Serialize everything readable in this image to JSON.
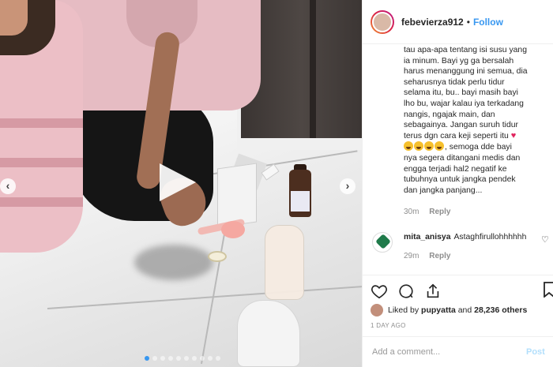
{
  "header": {
    "username": "febevierza912",
    "separator": "•",
    "follow_label": "Follow"
  },
  "caption": {
    "line1": "tau apa-apa tentang isi susu yang\nia minum. Bayi yg ga bersalah\nharus menanggung ini semua, dia\nseharusnya tidak perlu tidur\nselama itu, bu.. bayi masih bayi\nlho bu, wajar kalau iya terkadang\nnangis, ngajak main, dan\nsebagainya. Jangan suruh tidur\nterus dgn cara keji seperti itu",
    "line2": ", semoga dde bayi\nnya segera ditangani medis dan\nengga terjadi hal2 negatif ke\ntubuhnya untuk jangka pendek\ndan jangka panjang...",
    "time": "30m",
    "reply_label": "Reply"
  },
  "comment2": {
    "username": "mita_anisya",
    "text": "Astaghfirullohhhhhh",
    "time": "29m",
    "reply_label": "Reply"
  },
  "likes": {
    "prefix": "Liked by",
    "user": "pupyatta",
    "and": "and",
    "others": "28,236 others"
  },
  "post_time": "1 DAY AGO",
  "add_comment": {
    "placeholder": "Add a comment...",
    "post_label": "Post"
  },
  "icons": {
    "heart": "heart-icon",
    "comment": "comment-icon",
    "share": "share-icon",
    "bookmark": "bookmark-icon"
  },
  "colors": {
    "accent": "#3897f0",
    "text": "#262626",
    "muted": "#8e8e8e"
  }
}
